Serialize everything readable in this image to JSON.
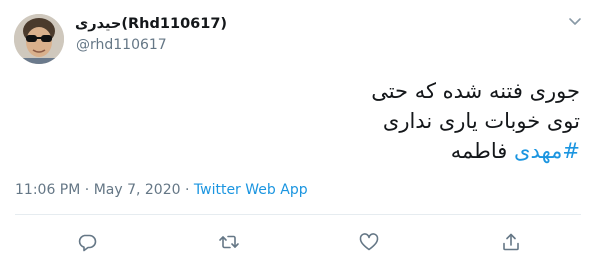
{
  "user": {
    "display_name": "حیدری(Rhd110617)",
    "handle": "@rhd110617"
  },
  "tweet": {
    "line1": "جوری فتنه شده که حتی",
    "line2": "توی خوبات یاری نداری",
    "hashtag": "#مهدی",
    "line3_rest": " فاطمه"
  },
  "meta": {
    "time": "11:06 PM",
    "separator1": " · ",
    "date": "May 7, 2020",
    "separator2": " · ",
    "source": "Twitter Web App"
  },
  "actions": [
    "reply-icon",
    "retweet-icon",
    "like-icon",
    "share-icon"
  ],
  "colors": {
    "link": "#1b95e0",
    "muted": "#657786",
    "text": "#14171a"
  }
}
